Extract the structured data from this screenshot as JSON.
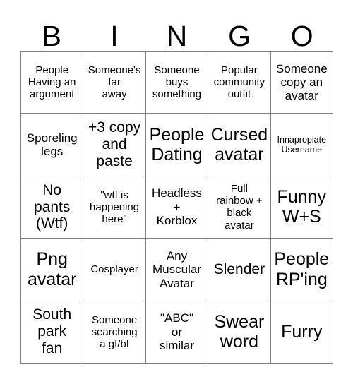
{
  "header": {
    "letters": [
      "B",
      "I",
      "N",
      "G",
      "O"
    ]
  },
  "grid": {
    "columns": 5,
    "rows": 5,
    "border_color": "#808080",
    "background_color": "#ffffff",
    "text_color": "#000000",
    "cells": [
      {
        "text": "People\nHaving an\nargument",
        "size": "sm"
      },
      {
        "text": "Someone's\nfar\naway",
        "size": "sm"
      },
      {
        "text": "Someone\nbuys\nsomething",
        "size": "sm"
      },
      {
        "text": "Popular\ncommunity\noutfit",
        "size": "sm"
      },
      {
        "text": "Someone\ncopy an\navatar",
        "size": "md"
      },
      {
        "text": "Sporeling\nlegs",
        "size": "md"
      },
      {
        "text": "+3 copy\nand\npaste",
        "size": "lg"
      },
      {
        "text": "People\nDating",
        "size": "xl"
      },
      {
        "text": "Cursed\navatar",
        "size": "xl"
      },
      {
        "text": "Innapropiate\nUsername",
        "size": "xs"
      },
      {
        "text": "No\npants\n(Wtf)",
        "size": "lg"
      },
      {
        "text": "\"wtf is\nhappening\nhere\"",
        "size": "sm"
      },
      {
        "text": "Headless\n+\nKorblox",
        "size": "md"
      },
      {
        "text": "Full\nrainbow +\nblack\navatar",
        "size": "sm"
      },
      {
        "text": "Funny\nW+S",
        "size": "xl"
      },
      {
        "text": "Png\navatar",
        "size": "xl"
      },
      {
        "text": "Cosplayer",
        "size": "sm"
      },
      {
        "text": "Any\nMuscular\nAvatar",
        "size": "md"
      },
      {
        "text": "Slender",
        "size": "lg"
      },
      {
        "text": "People\nRP'ing",
        "size": "xl"
      },
      {
        "text": "South\npark\nfan",
        "size": "lg"
      },
      {
        "text": "Someone\nsearching\na gf/bf",
        "size": "sm"
      },
      {
        "text": "\"ABC\"\nor\nsimilar",
        "size": "md"
      },
      {
        "text": "Swear\nword",
        "size": "xl"
      },
      {
        "text": "Furry",
        "size": "xl"
      }
    ]
  }
}
